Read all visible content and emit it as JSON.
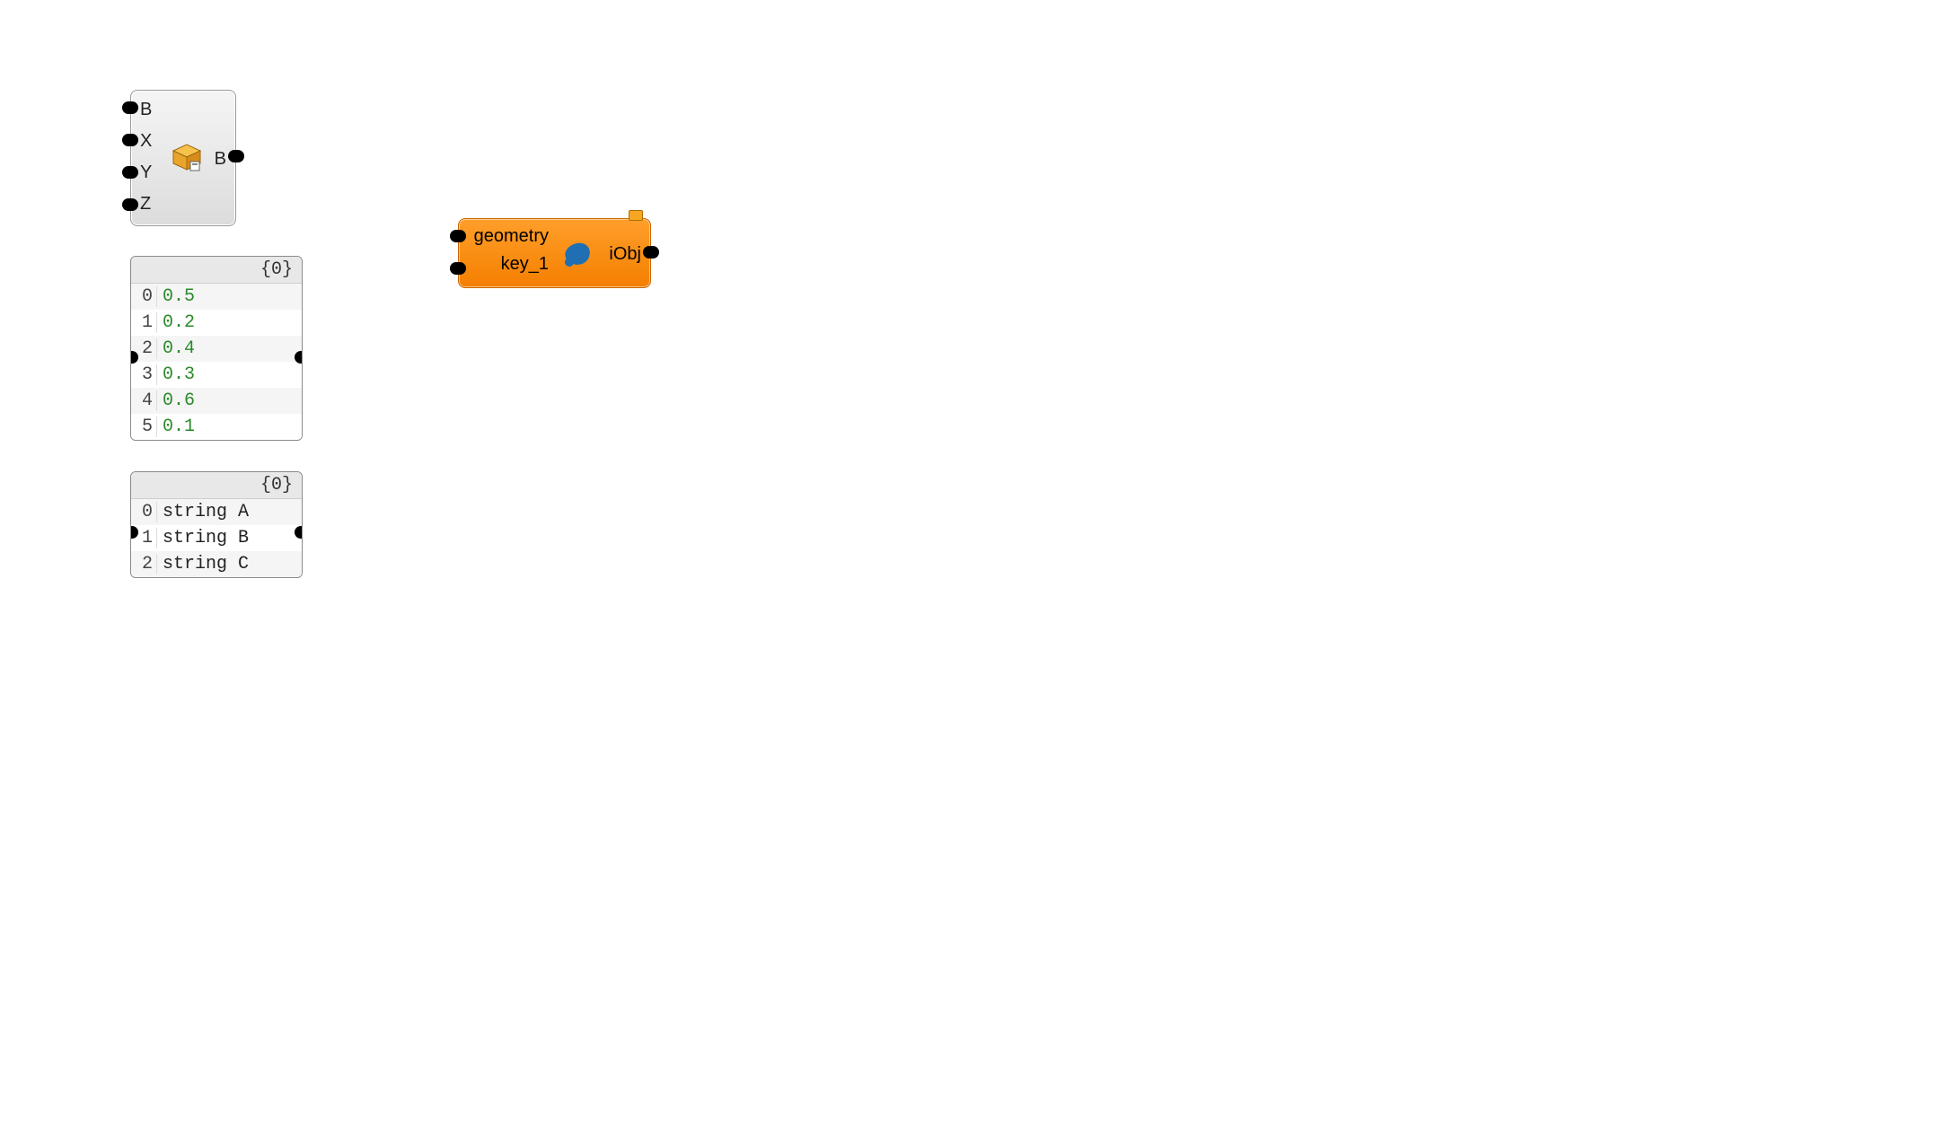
{
  "boxComponent": {
    "inputs": [
      "B",
      "X",
      "Y",
      "Z"
    ],
    "output": "B"
  },
  "panel1": {
    "header": "{0}",
    "rows": [
      {
        "idx": "0",
        "val": "0.5"
      },
      {
        "idx": "1",
        "val": "0.2"
      },
      {
        "idx": "2",
        "val": "0.4"
      },
      {
        "idx": "3",
        "val": "0.3"
      },
      {
        "idx": "4",
        "val": "0.6"
      },
      {
        "idx": "5",
        "val": "0.1"
      }
    ]
  },
  "panel2": {
    "header": "{0}",
    "rows": [
      {
        "idx": "0",
        "val": "string A"
      },
      {
        "idx": "1",
        "val": "string B"
      },
      {
        "idx": "2",
        "val": "string C"
      }
    ]
  },
  "orangeComponent": {
    "inputs": [
      "geometry",
      "key_1"
    ],
    "output": "iObj"
  }
}
